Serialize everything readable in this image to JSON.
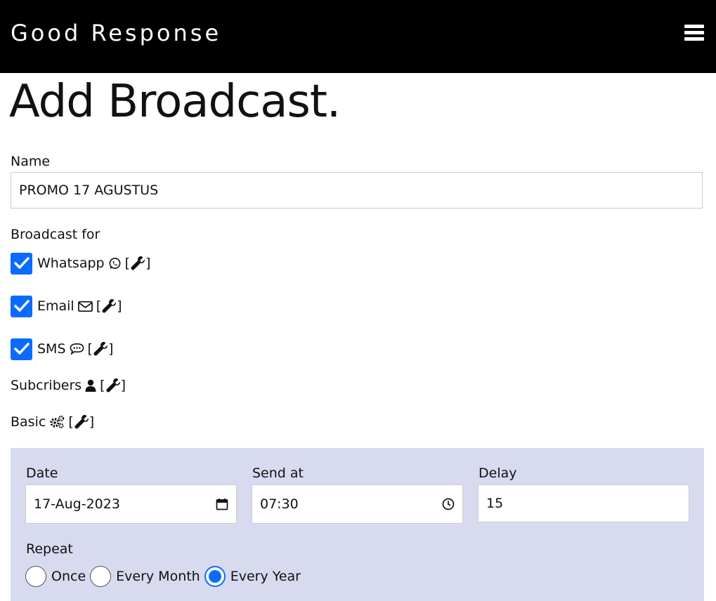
{
  "header": {
    "brand": "Good Response",
    "menu_icon": "hamburger-menu-icon"
  },
  "page_title": "Add Broadcast.",
  "name_field": {
    "label": "Name",
    "value": "PROMO 17 AGUSTUS"
  },
  "broadcast_for": {
    "label": "Broadcast for",
    "channels": [
      {
        "label": "Whatsapp",
        "icon": "whatsapp-icon",
        "checked": true
      },
      {
        "label": "Email",
        "icon": "envelope-icon",
        "checked": true
      },
      {
        "label": "SMS",
        "icon": "sms-bubble-icon",
        "checked": true
      }
    ]
  },
  "sections": [
    {
      "label": "Subcribers",
      "icon": "user-icon"
    },
    {
      "label": "Basic",
      "icon": "gears-icon"
    }
  ],
  "bracket_open": "[",
  "bracket_close": "]",
  "schedule": {
    "date_label": "Date",
    "date_value": "17-Aug-2023",
    "time_label": "Send at",
    "time_value": "07:30",
    "delay_label": "Delay",
    "delay_value": "15",
    "repeat_label": "Repeat",
    "repeat_options": [
      "Once",
      "Every Month",
      "Every Year"
    ],
    "repeat_selected": "Every Year"
  },
  "colors": {
    "header_bg": "#000000",
    "accent": "#0b6bfd",
    "panel_bg": "#d8dbef"
  }
}
